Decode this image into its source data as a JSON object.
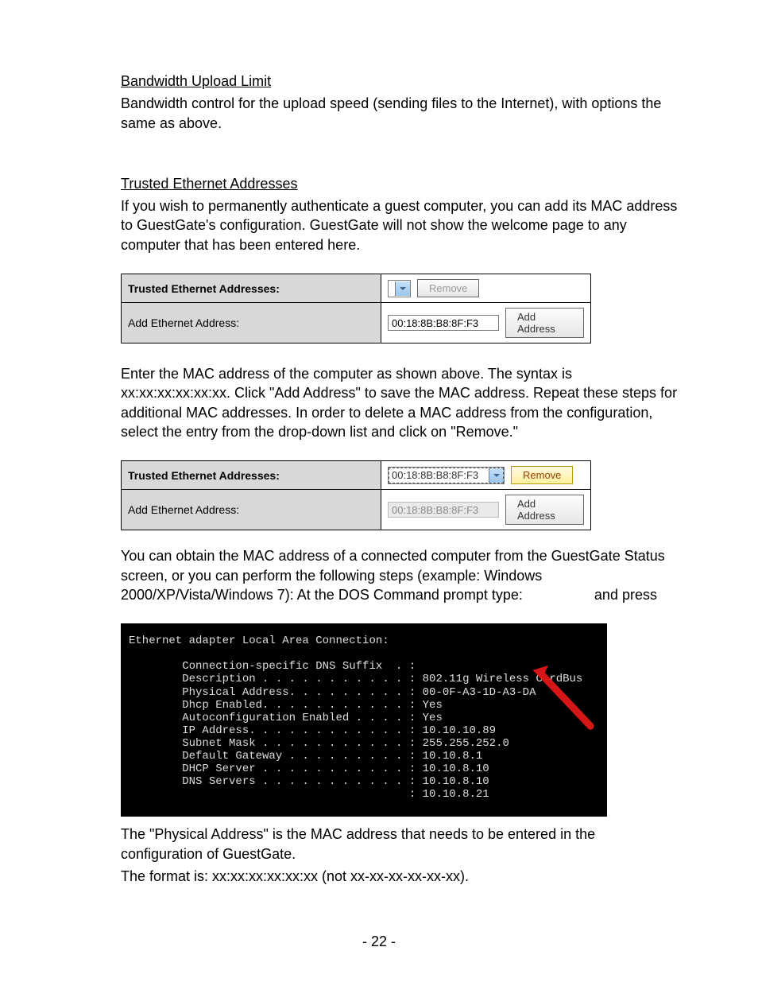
{
  "headings": {
    "bandwidthUploadLimit": "Bandwidth Upload Limit",
    "trustedEthernetAddresses": "Trusted Ethernet Addresses"
  },
  "paragraphs": {
    "bandwidthUploadBody": "Bandwidth control for the upload speed (sending files to the Internet), with options the same as above.",
    "trustedEthBody": "If you wish to permanently authenticate a guest computer, you can add its MAC address to GuestGate's configuration. GuestGate will not show the welcome page to any computer that has been entered here.",
    "enterMacBody": "Enter the MAC address of the computer as shown above. The syntax is xx:xx:xx:xx:xx:xx. Click \"Add Address\" to save the MAC address. Repeat these steps for additional MAC addresses. In order to delete a MAC address from the configuration, select the entry from the drop-down list and click on \"Remove.\"",
    "obtainMacBody": "You can obtain the MAC address of a connected computer from the GuestGate Status screen, or you can perform the following steps (example: Windows 2000/XP/Vista/Windows 7): At the DOS Command prompt type:                  and press",
    "physicalAddressBody": "The \"Physical Address\" is the MAC address that needs to be entered in the configuration of GuestGate.",
    "formatBody": "The format is: xx:xx:xx:xx:xx:xx (not xx-xx-xx-xx-xx-xx)."
  },
  "uiTable1": {
    "row1Label": "Trusted Ethernet Addresses:",
    "row1DropdownValue": "",
    "row1Button": "Remove",
    "row2Label": "Add Ethernet Address:",
    "row2InputValue": "00:18:8B:B8:8F:F3",
    "row2Button": "Add Address"
  },
  "uiTable2": {
    "row1Label": "Trusted Ethernet Addresses:",
    "row1DropdownValue": "00:18:8B:B8:8F:F3",
    "row1Button": "Remove",
    "row2Label": "Add Ethernet Address:",
    "row2InputValue": "00:18:8B:B8:8F:F3",
    "row2Button": "Add Address"
  },
  "terminal": {
    "header": "Ethernet adapter Local Area Connection:",
    "lines": [
      {
        "k": "Connection-specific DNS Suffix  .",
        "v": ""
      },
      {
        "k": "Description . . . . . . . . . . .",
        "v": "802.11g Wireless CardBus"
      },
      {
        "k": "Physical Address. . . . . . . . .",
        "v": "00-0F-A3-1D-A3-DA"
      },
      {
        "k": "Dhcp Enabled. . . . . . . . . . .",
        "v": "Yes"
      },
      {
        "k": "Autoconfiguration Enabled . . . .",
        "v": "Yes"
      },
      {
        "k": "IP Address. . . . . . . . . . . .",
        "v": "10.10.10.89"
      },
      {
        "k": "Subnet Mask . . . . . . . . . . .",
        "v": "255.255.252.0"
      },
      {
        "k": "Default Gateway . . . . . . . . .",
        "v": "10.10.8.1"
      },
      {
        "k": "DHCP Server . . . . . . . . . . .",
        "v": "10.10.8.10"
      },
      {
        "k": "DNS Servers . . . . . . . . . . .",
        "v": "10.10.8.10"
      },
      {
        "k": "                                 ",
        "v": "10.10.8.21"
      }
    ]
  },
  "pageNumber": "- 22 -"
}
